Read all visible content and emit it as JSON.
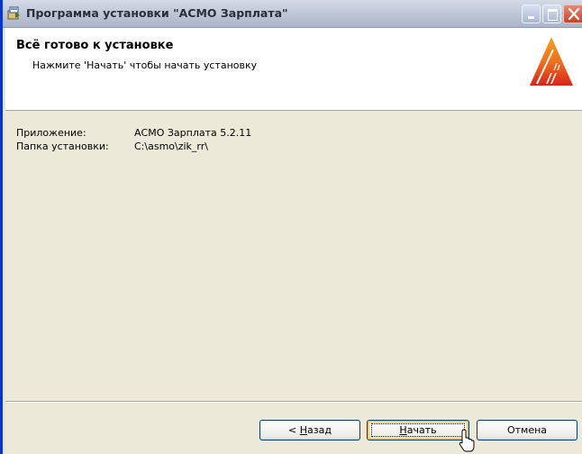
{
  "window": {
    "title": "Программа установки \"АСМО Зарплата\""
  },
  "header": {
    "title": "Всё готово к установке",
    "subtitle": "Нажмите 'Начать' чтобы начать установку"
  },
  "info": {
    "app_label": "Приложение:",
    "app_value": "АСМО Зарплата 5.2.11",
    "folder_label": "Папка установки:",
    "folder_value": "C:\\asmo\\zik_rr\\"
  },
  "buttons": {
    "back_prefix": "< ",
    "back_mnemonic": "Н",
    "back_rest": "азад",
    "start_mnemonic": "Н",
    "start_rest": "ачать",
    "cancel": "Отмена"
  },
  "colors": {
    "logo_orange": "#f07a1a",
    "logo_red": "#d8241c",
    "title_bar": "#c1c9d8"
  },
  "icons": [
    "installer-icon",
    "minimize-icon",
    "maximize-icon",
    "close-icon",
    "app-logo",
    "mouse-cursor"
  ]
}
